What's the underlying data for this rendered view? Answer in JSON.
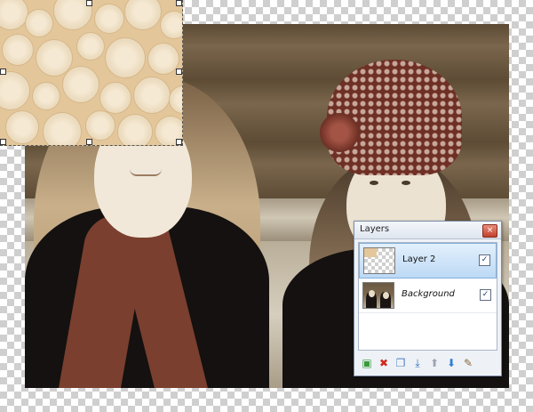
{
  "layers_panel": {
    "title": "Layers",
    "close_glyph": "×",
    "layers": [
      {
        "name": "Layer 2",
        "visible": true,
        "selected": true,
        "check_glyph": "✓",
        "thumbnail": "transparent-with-pattern"
      },
      {
        "name": "Background",
        "visible": true,
        "selected": false,
        "check_glyph": "✓",
        "thumbnail": "photo"
      }
    ],
    "toolbar": [
      {
        "name": "add-layer-icon",
        "glyph": "▣",
        "color": "#3a9a3a"
      },
      {
        "name": "delete-layer-icon",
        "glyph": "✖",
        "color": "#d0281c"
      },
      {
        "name": "duplicate-layer-icon",
        "glyph": "❐",
        "color": "#4f7fbf"
      },
      {
        "name": "merge-layer-down-icon",
        "glyph": "⤓",
        "color": "#2f6fc0"
      },
      {
        "name": "move-layer-up-icon",
        "glyph": "⬆",
        "color": "#9aa4b2"
      },
      {
        "name": "move-layer-down-icon",
        "glyph": "⬇",
        "color": "#2f7fd8"
      },
      {
        "name": "layer-properties-icon",
        "glyph": "✎",
        "color": "#8a6a3a"
      }
    ]
  },
  "colors": {
    "pattern_background": "#e3c69a",
    "selection_highlight": "#bcd9f5",
    "close_button": "#c1402b"
  }
}
